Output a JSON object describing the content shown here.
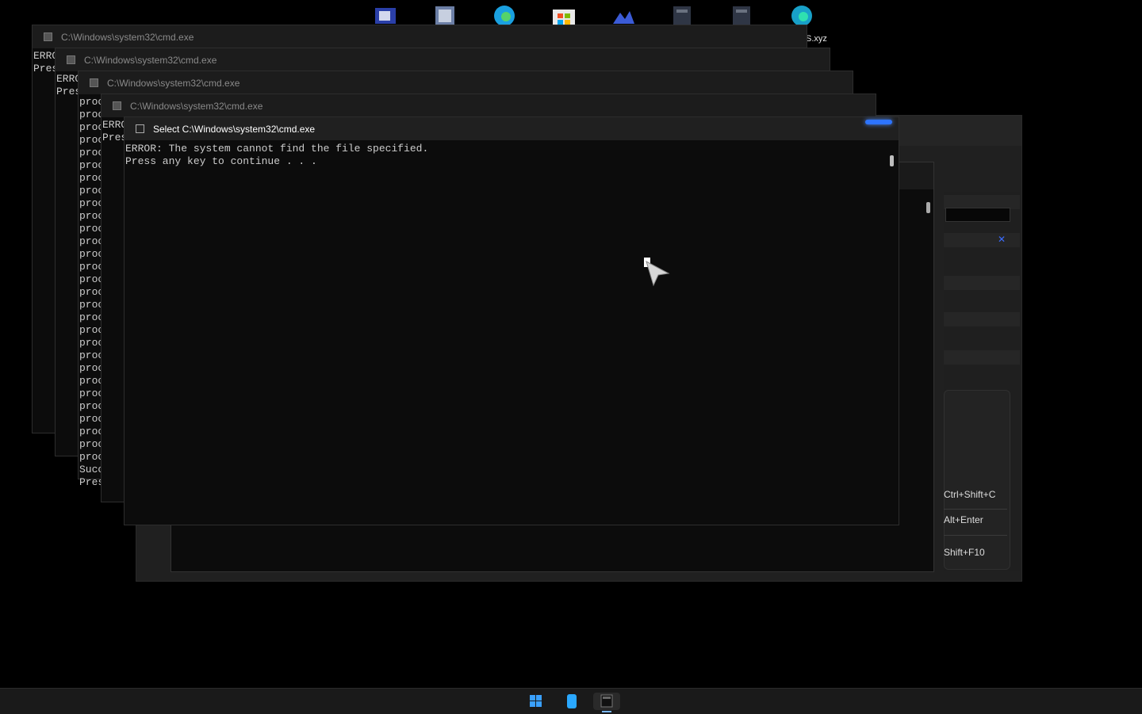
{
  "desktop": {
    "icons": [
      {
        "name": "app-icon-1",
        "color": "#2a3fa8"
      },
      {
        "name": "app-icon-2",
        "color": "#6c7fa6"
      },
      {
        "name": "edge-icon",
        "color": "#1aa0e0"
      },
      {
        "name": "store-icon",
        "color": "#e8e8e8"
      },
      {
        "name": "app-icon-5",
        "color": "#3b5bd6"
      },
      {
        "name": "app-icon-6",
        "color": "#2f3645"
      },
      {
        "name": "app-icon-7",
        "color": "#2f3645"
      },
      {
        "name": "edge-dev-icon",
        "color": "#18a0c8"
      }
    ],
    "shortcut_label": "S.xyz"
  },
  "windows": [
    {
      "title": "C:\\Windows\\system32\\cmd.exe",
      "lines": [
        "ERRO",
        "Pres"
      ]
    },
    {
      "title": "C:\\Windows\\system32\\cmd.exe",
      "lines": [
        "ERRO",
        "Pres"
      ]
    },
    {
      "title": "C:\\Windows\\system32\\cmd.exe",
      "lines": [
        "proc",
        "proc",
        "proc",
        "proc",
        "proc",
        "proc",
        "proc",
        "proc",
        "proc",
        "proc",
        "proc",
        "proc",
        "proc",
        "proc",
        "proc",
        "proc",
        "proc",
        "proc",
        "proc",
        "proc",
        "proc",
        "proc",
        "proc",
        "proc",
        "proc",
        "proc",
        "proc",
        "proc",
        "proc",
        "Succ",
        "Pres"
      ]
    },
    {
      "title": "C:\\Windows\\system32\\cmd.exe",
      "lines": [
        "ERRO",
        "Pres"
      ]
    },
    {
      "title": "Select C:\\Windows\\system32\\cmd.exe",
      "lines": [
        "ERROR: The system cannot find the file specified.",
        "Press any key to continue . . ."
      ]
    }
  ],
  "context_menu": {
    "shortcuts": [
      "Ctrl+Shift+C",
      "Alt+Enter",
      "Shift+F10"
    ]
  },
  "taskbar": {
    "buttons": [
      "start-button",
      "files-app-button",
      "terminal-app-button"
    ]
  }
}
